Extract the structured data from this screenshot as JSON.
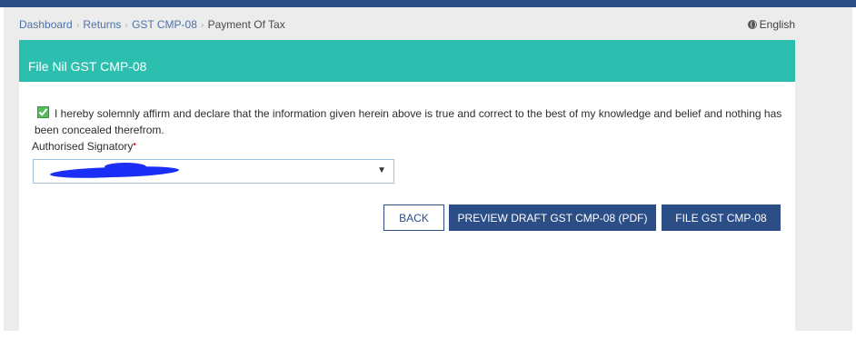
{
  "breadcrumb": {
    "items": [
      "Dashboard",
      "Returns",
      "GST CMP-08"
    ],
    "current": "Payment Of Tax"
  },
  "language": {
    "label": "English",
    "icon": "globe-icon"
  },
  "panel": {
    "title": "File Nil GST CMP-08",
    "declaration": "I hereby solemnly affirm and declare that the information given herein above is true and correct to the best of my knowledge and belief and nothing has been concealed therefrom.",
    "declaration_checked": true,
    "signatory_label": "Authorised Signatory",
    "required_marker": "•",
    "select_arrow": "▼"
  },
  "buttons": {
    "back": "BACK",
    "preview": "PREVIEW DRAFT GST CMP-08 (PDF)",
    "file": "FILE GST CMP-08"
  },
  "colors": {
    "header": "#2cbfb0",
    "primary": "#2c4e86",
    "checkbox": "#5cb85c",
    "required": "#d9212c"
  }
}
